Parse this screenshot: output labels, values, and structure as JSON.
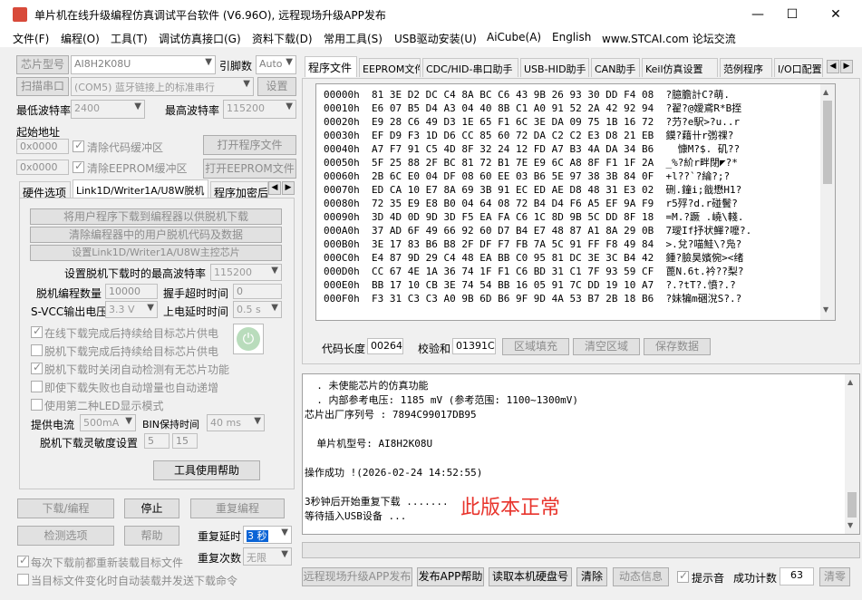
{
  "window": {
    "title": "单片机在线升级编程仿真调试平台软件 (V6.96O), 远程现场升级APP发布",
    "minimize": "—",
    "maximize": "☐",
    "close": "✕"
  },
  "menu": [
    "文件(F)",
    "编程(O)",
    "工具(T)",
    "调试仿真接口(G)",
    "资料下载(D)",
    "常用工具(S)",
    "USB驱动安装(U)",
    "AiCube(A)",
    "English",
    "www.STCAI.com 论坛交流"
  ],
  "left": {
    "chip_btn": "芯片型号",
    "chip_value": "AI8H2K08U",
    "pins_label": "引脚数",
    "pins_value": "Auto",
    "scan_btn": "扫描串口",
    "port_value": "(COM5) 蓝牙链接上的标准串行",
    "settings_btn": "设置",
    "min_baud_label": "最低波特率",
    "min_baud_value": "2400",
    "max_baud_label": "最高波特率",
    "max_baud_value": "115200",
    "start_addr_label": "起始地址",
    "addr1": "0x0000",
    "addr2": "0x0000",
    "clear_code": "清除代码缓冲区",
    "clear_eeprom": "清除EEPROM缓冲区",
    "open_prog_btn": "打开程序文件",
    "open_eeprom_btn": "打开EEPROM文件",
    "tabs": [
      "硬件选项",
      "Link1D/Writer1A/U8W脱机",
      "程序加密后"
    ],
    "offline": {
      "btn1": "将用户程序下载到编程器以供脱机下载",
      "btn2": "清除编程器中的用户脱机代码及数据",
      "btn3": "设置Link1D/Writer1A/U8W主控芯片",
      "max_baud_label": "设置脱机下载时的最高波特率",
      "max_baud_value": "115200",
      "count_label": "脱机编程数量",
      "count_value": "10000",
      "timeout_label": "握手超时时间",
      "timeout_value": "0",
      "vcc_label": "S-VCC输出电压",
      "vcc_value": "3.3 V",
      "delay_label": "上电延时时间",
      "delay_value": "0.5 s",
      "chk1": "在线下载完成后持续给目标芯片供电",
      "chk2": "脱机下载完成后持续给目标芯片供电",
      "chk3": "脱机下载时关闭自动检测有无芯片功能",
      "chk4": "即使下载失败也自动增量也自动递增",
      "chk5": "使用第二种LED显示模式",
      "current_label": "提供电流",
      "current_value": "500mA",
      "bin_label": "BIN保持时间",
      "bin_value": "40 ms",
      "sens_label": "脱机下载灵敏度设置",
      "sens1": "5",
      "sens2": "15",
      "help_btn": "工具使用帮助"
    },
    "download_btn": "下载/编程",
    "stop_btn": "停止",
    "reprog_btn": "重复编程",
    "detect_btn": "检测选项",
    "help_btn": "帮助",
    "repeat_delay_label": "重复延时",
    "repeat_delay_value": "3 秒",
    "repeat_count_label": "重复次数",
    "repeat_count_value": "无限",
    "reload_chk": "每次下载前都重新装载目标文件",
    "auto_send_chk": "当目标文件变化时自动装载并发送下载命令"
  },
  "right": {
    "tabs": [
      "程序文件",
      "EEPROM文件",
      "CDC/HID-串口助手",
      "USB-HID助手",
      "CAN助手",
      "Keil仿真设置",
      "范例程序",
      "I/O口配置"
    ],
    "hex": [
      {
        "addr": "00000h",
        "bytes": "81 3E D2 DC C4 8A BC C6 43 9B 26 93 30 DD F4 08",
        "ascii": "?臆膽計C?萌."
      },
      {
        "addr": "00010h",
        "bytes": "E6 07 B5 D4 A3 04 40 8B C1 A0 91 52 2A 42 92 94",
        "ascii": "?翟?@嬡鳶R*B挃"
      },
      {
        "addr": "00020h",
        "bytes": "E9 28 C6 49 D3 1E 65 F1 6C 3E DA 09 75 1B 16 72",
        "ascii": "?芀?e駅>?u..r"
      },
      {
        "addr": "00030h",
        "bytes": "EF D9 F3 1D D6 CC 85 60 72 DA C2 C2 E3 D8 21 EB",
        "ascii": "鏌?藉卄r彅祼?"
      },
      {
        "addr": "00040h",
        "bytes": "A7 F7 91 C5 4D 8F 32 24 12 FD A7 B3 4A DA 34 B6",
        "ascii": "  慷M?$. 矶??"
      },
      {
        "addr": "00050h",
        "bytes": "5F 25 88 2F BC 81 72 B1 7E E9 6C A8 8F F1 1F 2A",
        "ascii": "_%?紒r畔閉◤?*"
      },
      {
        "addr": "00060h",
        "bytes": "2B 6C E0 04 DF 08 60 EE 03 B6 5E 97 38 3B 84 0F",
        "ascii": "+l??`?綸?;?"
      },
      {
        "addr": "00070h",
        "bytes": "ED CA 10 E7 8A 69 3B 91 EC ED AE D8 48 31 E3 02",
        "ascii": "硎.鐘i;戠懋H1?"
      },
      {
        "addr": "00080h",
        "bytes": "72 35 E9 E8 B0 04 64 08 72 B4 D4 F6 A5 EF 9A F9",
        "ascii": "r5殍?d.r碰鬢?"
      },
      {
        "addr": "00090h",
        "bytes": "3D 4D 0D 9D 3D F5 EA FA C6 1C 8D 9B 5C DD 8F 18",
        "ascii": "=M.?蹶 .嶢\\輚."
      },
      {
        "addr": "000A0h",
        "bytes": "37 AD 6F 49 66 92 60 D7 B4 E7 48 87 A1 8A 29 0B",
        "ascii": "7璦If抒状鯶?嚒?."
      },
      {
        "addr": "000B0h",
        "bytes": "3E 17 83 B6 B8 2F DF F7 FB 7A 5C 91 FF F8 49 84",
        "ascii": ">.兌?喵鮭\\?凫?"
      },
      {
        "addr": "000C0h",
        "bytes": "E4 87 9D 29 C4 48 EA BB C0 95 81 DC 3E 3C B4 42",
        "ascii": "鍾?臉昊嬪倇><绪"
      },
      {
        "addr": "000D0h",
        "bytes": "CC 67 4E 1A 36 74 1F F1 C6 BD 31 C1 7F 93 59 CF",
        "ascii": "蓖N.6t.衿??梨?"
      },
      {
        "addr": "000E0h",
        "bytes": "BB 17 10 CB 3E 74 54 BB 16 05 91 7C DD 19 10 A7",
        "ascii": "?.?tT?.憤?.?"
      },
      {
        "addr": "000F0h",
        "bytes": "F3 31 C3 C3 A0 9B 6D B6 9F 9D 4A 53 B7 2B 18 B6",
        "ascii": "?妹犏m硱涗S?.?"
      }
    ],
    "code_len_label": "代码长度",
    "code_len_value": "00264",
    "checksum_label": "校验和",
    "checksum_value": "01391C",
    "fill_btn": "区域填充",
    "clear_btn": "清空区域",
    "save_btn": "保存数据",
    "log": [
      "  . 未使能芯片的仿真功能",
      "  . 内部参考电压: 1185 mV (参考范围: 1100~1300mV)",
      "芯片出厂序列号 : 7894C99017DB95",
      "",
      "  单片机型号: AI8H2K08U",
      "",
      "操作成功 !(2026-02-24 14:52:55)",
      "",
      "3秒钟后开始重复下载 .......",
      "等待插入USB设备 ..."
    ],
    "status_msg": "此版本正常",
    "publish_btn": "远程现场升级APP发布",
    "publish_help_btn": "发布APP帮助",
    "read_disk_btn": "读取本机硬盘号",
    "clear_log_btn": "清除",
    "animation_btn": "动态信息",
    "beep_chk": "提示音",
    "success_label": "成功计数",
    "success_value": "63",
    "reset_btn": "清零"
  }
}
